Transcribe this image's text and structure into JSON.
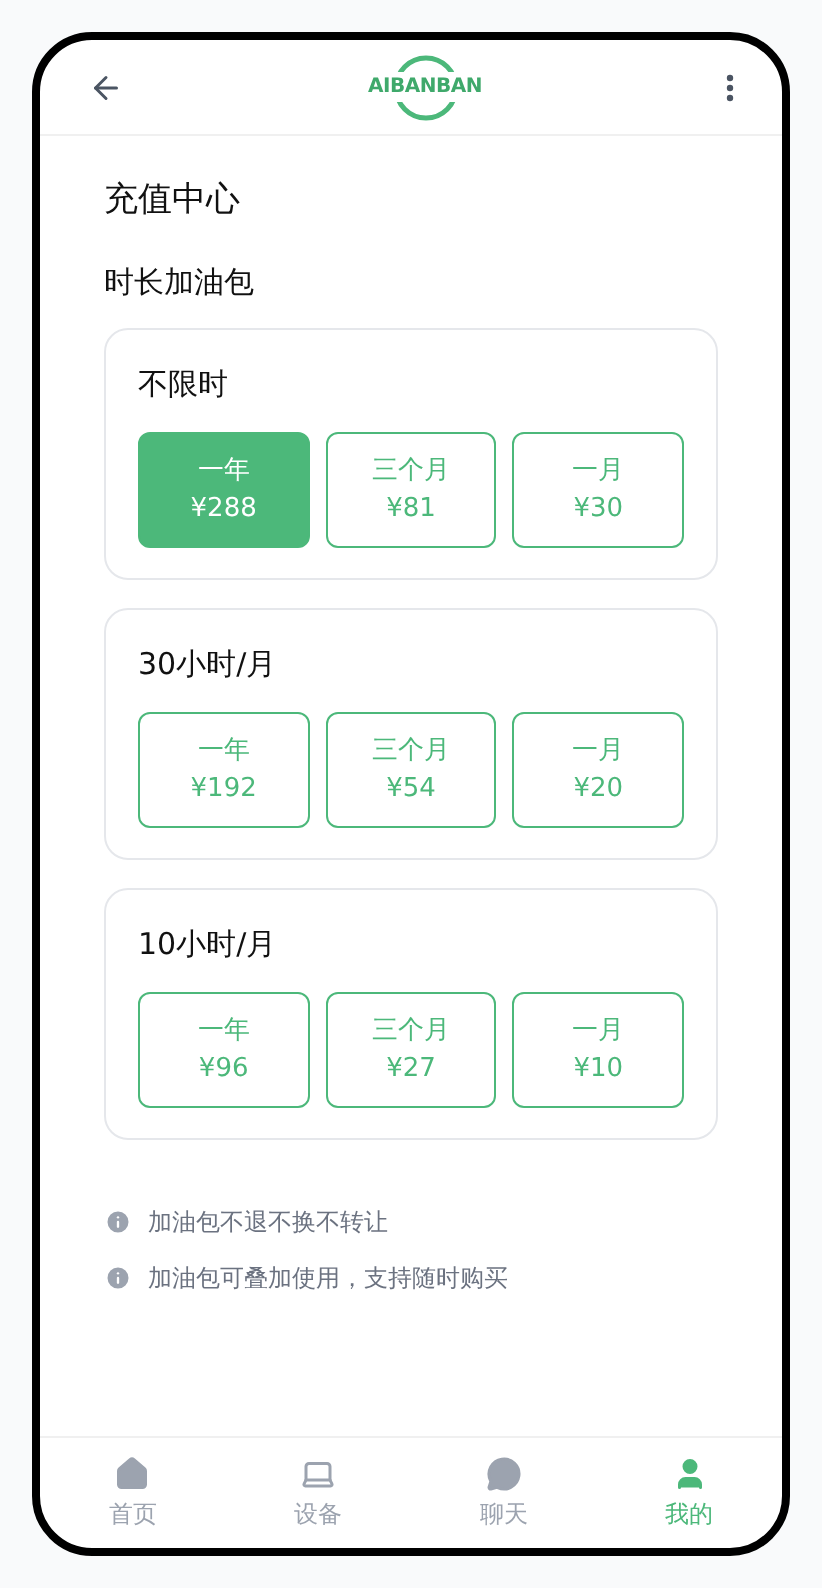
{
  "header": {
    "logo": "AIBANBAN"
  },
  "title": "充值中心",
  "section": "时长加油包",
  "packages": [
    {
      "name": "不限时",
      "options": [
        {
          "period": "一年",
          "price": "¥288",
          "selected": true
        },
        {
          "period": "三个月",
          "price": "¥81",
          "selected": false
        },
        {
          "period": "一月",
          "price": "¥30",
          "selected": false
        }
      ]
    },
    {
      "name": "30小时/月",
      "options": [
        {
          "period": "一年",
          "price": "¥192",
          "selected": false
        },
        {
          "period": "三个月",
          "price": "¥54",
          "selected": false
        },
        {
          "period": "一月",
          "price": "¥20",
          "selected": false
        }
      ]
    },
    {
      "name": "10小时/月",
      "options": [
        {
          "period": "一年",
          "price": "¥96",
          "selected": false
        },
        {
          "period": "三个月",
          "price": "¥27",
          "selected": false
        },
        {
          "period": "一月",
          "price": "¥10",
          "selected": false
        }
      ]
    }
  ],
  "notes": [
    "加油包不退不换不转让",
    "加油包可叠加使用，支持随时购买"
  ],
  "nav": [
    {
      "label": "首页",
      "kind": "home",
      "selected": false
    },
    {
      "label": "设备",
      "kind": "device",
      "selected": false
    },
    {
      "label": "聊天",
      "kind": "chat",
      "selected": false
    },
    {
      "label": "我的",
      "kind": "me",
      "selected": true
    }
  ]
}
